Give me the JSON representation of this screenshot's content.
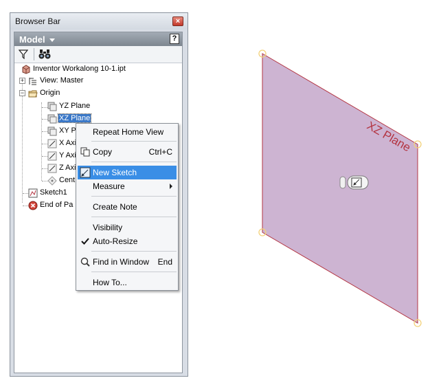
{
  "window": {
    "title": "Browser Bar",
    "close_glyph": "×"
  },
  "panel": {
    "model_label": "Model",
    "help_glyph": "?"
  },
  "tree": [
    {
      "label": "Inventor Workalong 10-1.ipt",
      "icon": "part-icon"
    },
    {
      "label": "View: Master",
      "icon": "view-icon"
    },
    {
      "label": "Origin",
      "icon": "folder-icon"
    },
    {
      "label": "YZ Plane",
      "icon": "plane-icon"
    },
    {
      "label": "XZ Plane",
      "icon": "plane-icon",
      "selected": true
    },
    {
      "label": "XY Pl",
      "icon": "plane-icon"
    },
    {
      "label": "X Axi",
      "icon": "axis-icon"
    },
    {
      "label": "Y Axi",
      "icon": "axis-icon"
    },
    {
      "label": "Z Axi",
      "icon": "axis-icon"
    },
    {
      "label": "Cent",
      "icon": "center-point-icon"
    },
    {
      "label": "Sketch1",
      "icon": "sketch-icon"
    },
    {
      "label": "End of Pa",
      "icon": "end-of-part-icon"
    }
  ],
  "context_menu": {
    "repeat_home_view": "Repeat Home View",
    "copy": "Copy",
    "copy_shortcut": "Ctrl+C",
    "new_sketch": "New Sketch",
    "measure": "Measure",
    "create_note": "Create Note",
    "visibility": "Visibility",
    "auto_resize": "Auto-Resize",
    "find_in_window": "Find in Window",
    "find_shortcut": "End",
    "how_to": "How To..."
  },
  "viewport": {
    "plane_label": "XZ Plane"
  },
  "colors": {
    "plane_fill": "#cdb4d2",
    "plane_edge": "#b33441",
    "highlight": "#3a8ee6",
    "selection": "#3a78c8"
  }
}
